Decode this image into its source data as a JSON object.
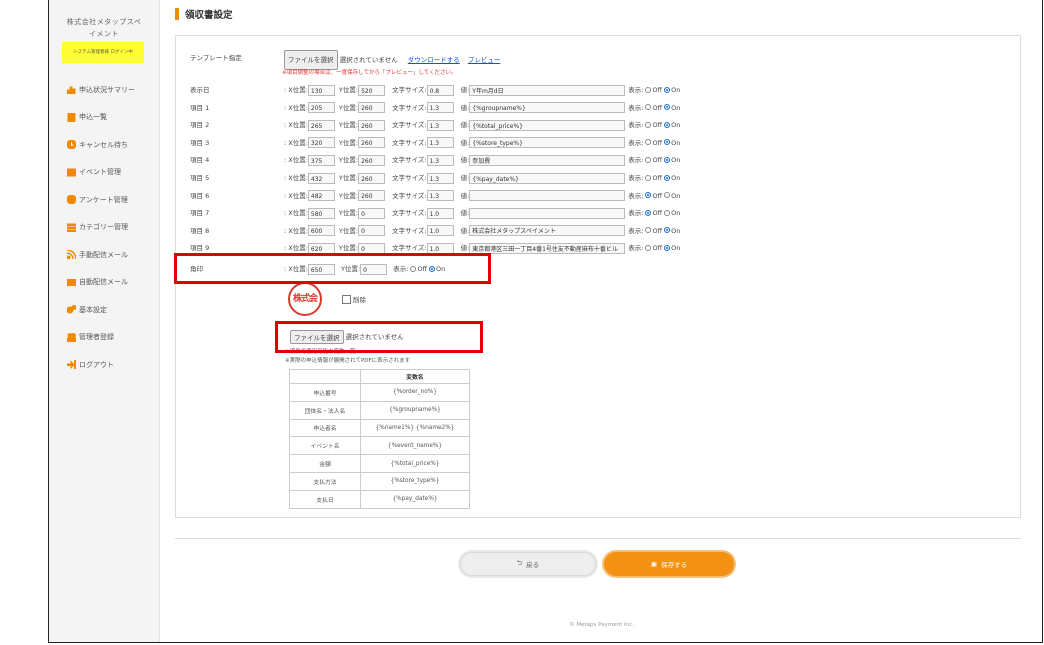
{
  "sidebar": {
    "company_line1": "株式会社メタップスペ",
    "company_line2": "イメント",
    "login_badge": "システム管理者様 ログイン中",
    "items": [
      {
        "label": "申込状況サマリー",
        "icon": "chart-icon",
        "color": "#f08a00"
      },
      {
        "label": "申込一覧",
        "icon": "book-icon",
        "color": "#f08a00"
      },
      {
        "label": "キャンセル待ち",
        "icon": "clock-icon",
        "color": "#f08a00"
      },
      {
        "label": "イベント管理",
        "icon": "grid-icon",
        "color": "#f08a00"
      },
      {
        "label": "アンケート管理",
        "icon": "pie-icon",
        "color": "#f08a00"
      },
      {
        "label": "カテゴリー管理",
        "icon": "list-icon",
        "color": "#f08a00"
      },
      {
        "label": "手動配信メール",
        "icon": "rss-icon",
        "color": "#f08a00"
      },
      {
        "label": "自動配信メール",
        "icon": "mail-icon",
        "color": "#f08a00"
      },
      {
        "label": "基本設定",
        "icon": "gears-icon",
        "color": "#f08a00"
      },
      {
        "label": "管理者登録",
        "icon": "users-icon",
        "color": "#f08a00"
      },
      {
        "label": "ログアウト",
        "icon": "logout-icon",
        "color": "#f08a00"
      }
    ]
  },
  "page_title": "領収書設定",
  "template": {
    "label": "テンプレート指定",
    "file_button": "ファイルを選択",
    "file_status": "選択されていません",
    "download_link": "ダウンロードする",
    "preview_link": "プレビュー",
    "note": "※項目調整の場合は、一度保存してから「プレビュー」してください。"
  },
  "field_labels": {
    "x": ": X位置:",
    "y": "Y位置:",
    "size": "文字サイズ:",
    "value": "値:",
    "display": "表示:",
    "off": "Off",
    "on": "On"
  },
  "rows": [
    {
      "label": "表示日",
      "x": "130",
      "y": "520",
      "size": "0.8",
      "value": "Y年m月d日",
      "on": true
    },
    {
      "label": "項目 1",
      "x": "205",
      "y": "260",
      "size": "1.3",
      "value": "{%groupname%}",
      "on": true
    },
    {
      "label": "項目 2",
      "x": "265",
      "y": "260",
      "size": "1.3",
      "value": "{%total_price%}",
      "on": true
    },
    {
      "label": "項目 3",
      "x": "320",
      "y": "260",
      "size": "1.3",
      "value": "{%store_type%}",
      "on": true
    },
    {
      "label": "項目 4",
      "x": "375",
      "y": "260",
      "size": "1.3",
      "value": "参加費",
      "on": true
    },
    {
      "label": "項目 5",
      "x": "432",
      "y": "260",
      "size": "1.3",
      "value": "{%pay_date%}",
      "on": true
    },
    {
      "label": "項目 6",
      "x": "482",
      "y": "260",
      "size": "1.3",
      "value": "",
      "on": false
    },
    {
      "label": "項目 7",
      "x": "580",
      "y": "0",
      "size": "1.0",
      "value": "",
      "on": false
    },
    {
      "label": "項目 8",
      "x": "600",
      "y": "0",
      "size": "1.0",
      "value": "株式会社メタップスペイメント",
      "on": true
    },
    {
      "label": "項目 9",
      "x": "620",
      "y": "0",
      "size": "1.0",
      "value": "東京都港区三田一丁目4番1号住友不動産麻布十番ビル",
      "on": true
    }
  ],
  "stamp": {
    "label": "角印",
    "x": "650",
    "y": "0",
    "on": true
  },
  "seal_text": "株式会社MP",
  "delete_label": "削除",
  "stamp_file": {
    "button": "ファイルを選択",
    "status": "選択されていません"
  },
  "variables_note_1": "※項目で使用可能な変数一覧",
  "variables_note_2": "※実際の申込情報が展開されてPDFに表示されます",
  "variables_table": {
    "header": "変数名",
    "rows": [
      {
        "name": "申込番号",
        "var": "{%order_no%}"
      },
      {
        "name": "団体名・法人名",
        "var": "{%groupname%}"
      },
      {
        "name": "申込者名",
        "var": "{%name1%} {%name2%}"
      },
      {
        "name": "イベント名",
        "var": "{%event_name%}"
      },
      {
        "name": "金額",
        "var": "{%total_price%}"
      },
      {
        "name": "支払方法",
        "var": "{%store_type%}"
      },
      {
        "name": "支払日",
        "var": "{%pay_date%}"
      }
    ]
  },
  "buttons": {
    "back": "戻る",
    "save": "保存する"
  },
  "footer": "© Metaps Payment Inc.",
  "colors": {
    "accent": "#f08a00",
    "highlight": "#e00000",
    "save": "#f39212"
  }
}
